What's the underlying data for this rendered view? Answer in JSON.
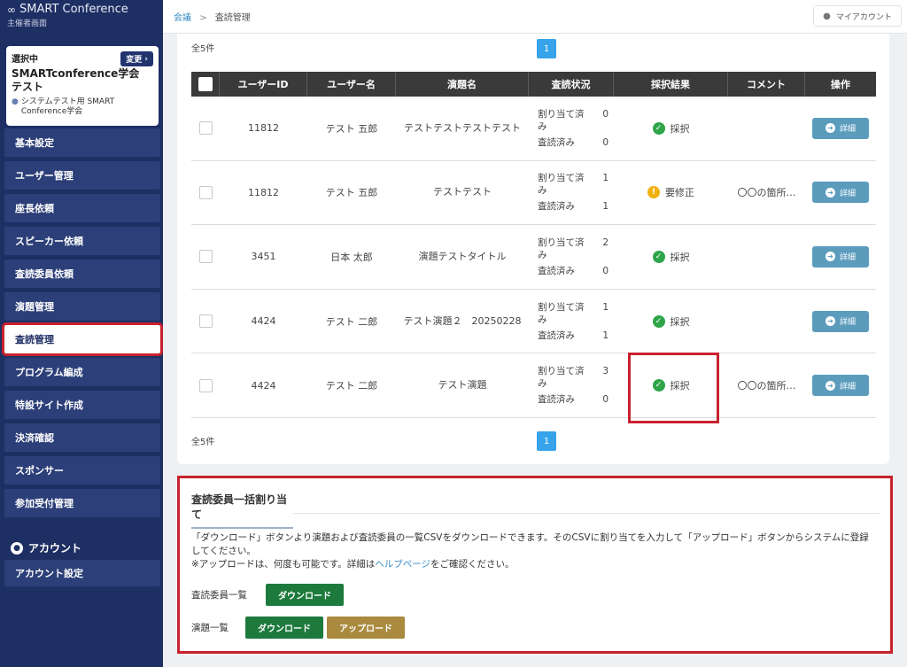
{
  "app": {
    "brand": "SMART Conference",
    "subtitle": "主催者画面"
  },
  "conference": {
    "selected_label": "選択中",
    "change_label": "変更",
    "name": "SMARTconference学会 テスト",
    "org": "システムテスト用 SMART Conference学会"
  },
  "sidebar": {
    "items": [
      {
        "label": "基本設定"
      },
      {
        "label": "ユーザー管理"
      },
      {
        "label": "座長依頼"
      },
      {
        "label": "スピーカー依頼"
      },
      {
        "label": "査読委員依頼"
      },
      {
        "label": "演題管理"
      },
      {
        "label": "査読管理"
      },
      {
        "label": "プログラム編成"
      },
      {
        "label": "特設サイト作成"
      },
      {
        "label": "決済確認"
      },
      {
        "label": "スポンサー"
      },
      {
        "label": "参加受付管理"
      }
    ],
    "account_heading": "アカウント",
    "account_setting": "アカウント設定"
  },
  "topbar": {
    "breadcrumb_root": "会議",
    "breadcrumb_sep": ">",
    "breadcrumb_current": "査読管理",
    "account_button": "マイアカウント"
  },
  "list": {
    "count_label": "全5件",
    "page": "1",
    "columns": [
      "ユーザーID",
      "ユーザー名",
      "演題名",
      "査読状況",
      "採択結果",
      "コメント",
      "操作"
    ],
    "status_assigned_label": "割り当て済み",
    "status_done_label": "査読済み",
    "detail_label": "詳細",
    "rows": [
      {
        "id": "11812",
        "name": "テスト 五郎",
        "title": "テストテストテストテスト",
        "assigned": "0",
        "done": "0",
        "result": "採択",
        "result_type": "ok",
        "comment": ""
      },
      {
        "id": "11812",
        "name": "テスト 五郎",
        "title": "テストテスト",
        "assigned": "1",
        "done": "1",
        "result": "要修正",
        "result_type": "warn",
        "comment": "〇〇の箇所…"
      },
      {
        "id": "3451",
        "name": "日本 太郎",
        "title": "演題テストタイトル",
        "assigned": "2",
        "done": "0",
        "result": "採択",
        "result_type": "ok",
        "comment": ""
      },
      {
        "id": "4424",
        "name": "テスト 二郎",
        "title": "テスト演題２　20250228",
        "assigned": "1",
        "done": "1",
        "result": "採択",
        "result_type": "ok",
        "comment": ""
      },
      {
        "id": "4424",
        "name": "テスト 二郎",
        "title": "テスト演題",
        "assigned": "3",
        "done": "0",
        "result": "採択",
        "result_type": "ok",
        "comment": "〇〇の箇所…"
      }
    ]
  },
  "bulk": {
    "title": "査読委員一括割り当て",
    "desc_line1": "「ダウンロード」ボタンより演題および査読委員の一覧CSVをダウンロードできます。そのCSVに割り当てを入力して「アップロード」ボタンからシステムに登録してください。",
    "desc_line2_pre": "※アップロードは、何度も可能です。詳細は",
    "desc_help": "ヘルプページ",
    "desc_line2_post": "をご確認ください。",
    "reviewers_label": "査読委員一覧",
    "abstracts_label": "演題一覧",
    "download_label": "ダウンロード",
    "upload_label": "アップロード"
  },
  "colors": {
    "sidebar": "#1e2f63",
    "menu_item": "#2c3f78",
    "highlight": "#c8212e",
    "ok": "#2fa54a",
    "warn": "#f1b20f",
    "pager": "#36a3ea",
    "detail": "#5b9cbd",
    "download": "#1d7a3c",
    "upload": "#a98a3e"
  }
}
